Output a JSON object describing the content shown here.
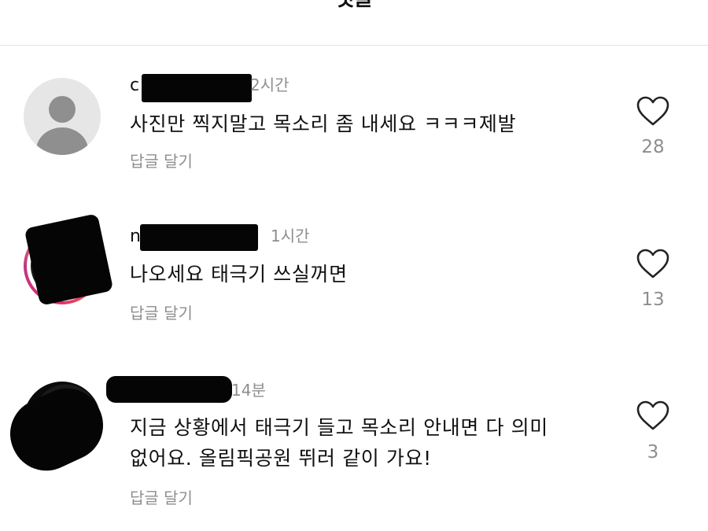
{
  "header": {
    "title": "댓글"
  },
  "comments": [
    {
      "username_visible": "c",
      "time": "2시간",
      "text_lines": [
        "사진만 찍지말고 목소리 좀 내세요 ㅋㅋㅋ제발"
      ],
      "reply_label": "답글 달기",
      "likes": "28",
      "avatar": "default-profile"
    },
    {
      "username_visible": "n",
      "username_visible_end": "n",
      "time": "1시간",
      "text_lines": [
        "나오세요 태극기 쓰실꺼면"
      ],
      "reply_label": "답글 달기",
      "likes": "13",
      "avatar": "story-ring-redacted"
    },
    {
      "username_visible": "",
      "time": "14분",
      "text_lines": [
        "지금 상황에서 태극기 들고 목소리 안내면 다 의미",
        "없어요. 올림픽공원 뛰러 같이 가요!"
      ],
      "reply_label": "답글 달기",
      "likes": "3",
      "avatar": "dark-redacted"
    }
  ],
  "icons": {
    "like": "heart-outline-icon"
  },
  "colors": {
    "meta_text": "#8e8e8e",
    "story_ring_start": "#f9b233",
    "story_ring_end": "#c13584"
  }
}
